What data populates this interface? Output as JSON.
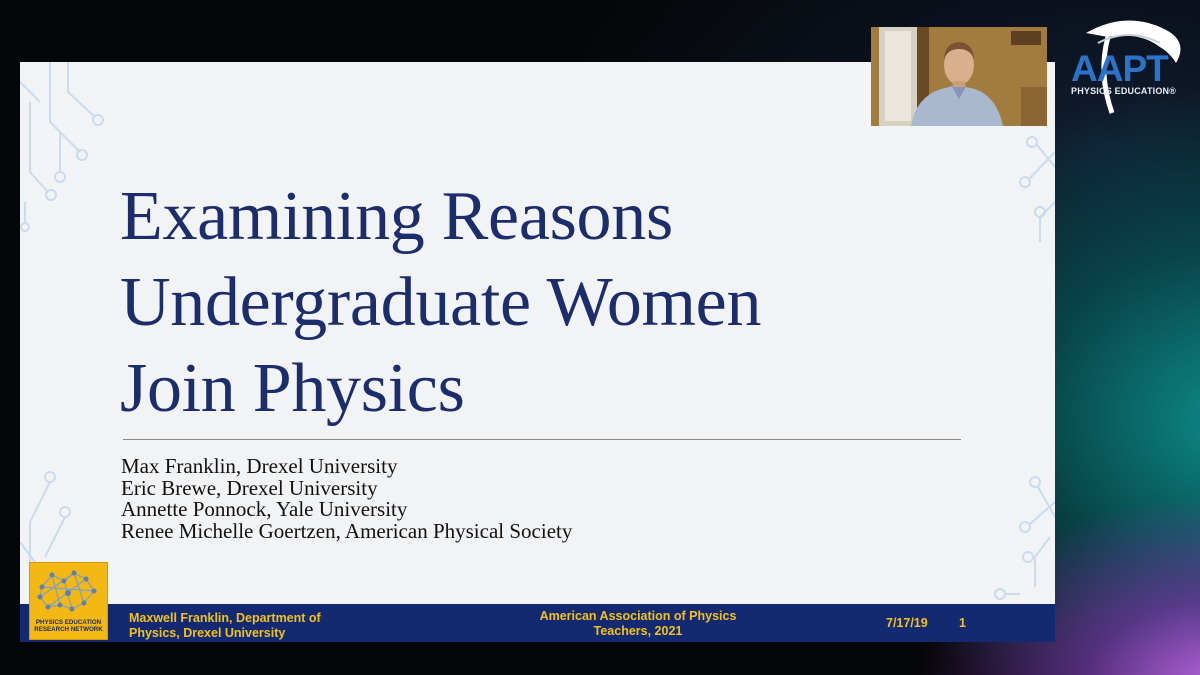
{
  "slide": {
    "title_lines": [
      "Examining Reasons",
      "Undergraduate Women",
      "Join Physics"
    ],
    "authors": [
      "Max Franklin, Drexel University",
      "Eric Brewe, Drexel University",
      "Annette Ponnock, Yale University",
      "Renee Michelle Goertzen, American Physical Society"
    ],
    "logo_text": [
      "PHYSICS EDUCATION",
      "RESEARCH NETWORK"
    ],
    "footer": {
      "presenter": [
        "Maxwell Franklin, Department of",
        "Physics, Drexel University"
      ],
      "venue": [
        "American Association of Physics",
        "Teachers, 2021"
      ],
      "date": "7/17/19",
      "page": "1"
    }
  },
  "overlay": {
    "brand": "AAPT",
    "brand_sub": "PHYSICS EDUCATION®",
    "webcam_label": "presenter webcam"
  },
  "colors": {
    "title": "#1c2d6b",
    "footer_bg": "#132a73",
    "footer_text": "#f2c21a",
    "logo_bg": "#f3b814",
    "aapt_blue": "#2c73c7"
  }
}
